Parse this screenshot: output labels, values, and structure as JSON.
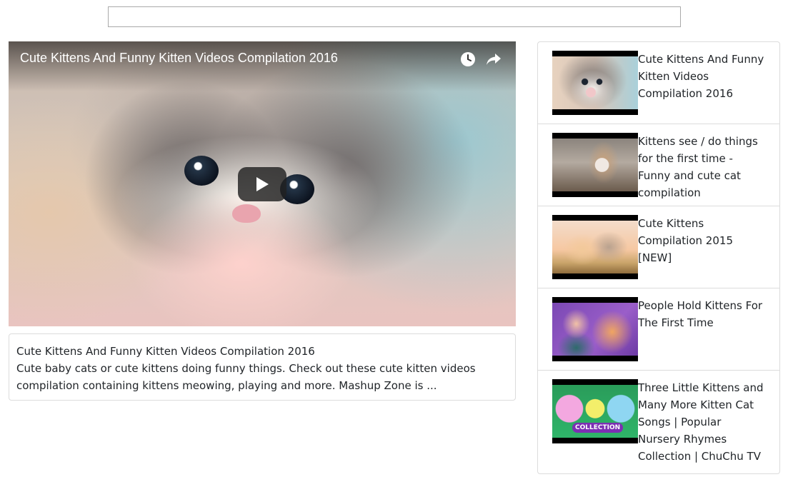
{
  "search": {
    "value": "",
    "placeholder": ""
  },
  "player": {
    "title": "Cute Kittens And Funny Kitten Videos Compilation 2016",
    "icons": {
      "watch_later": "clock-icon",
      "share": "share-arrow-icon",
      "play": "play-icon"
    }
  },
  "description": {
    "title": "Cute Kittens And Funny Kitten Videos Compilation 2016",
    "text": "Cute baby cats or cute kittens doing funny things. Check out these cute kitten videos compilation containing kittens meowing, playing and more. Mashup Zone is ..."
  },
  "related": [
    {
      "title": "Cute Kittens And Funny Kitten Videos Compilation 2016"
    },
    {
      "title": "Kittens see / do things for the first time - Funny and cute cat compilation"
    },
    {
      "title": "Cute Kittens Compilation 2015 [NEW]"
    },
    {
      "title": "People Hold Kittens For The First Time"
    },
    {
      "title": "Three Little Kittens and Many More Kitten Cat Songs | Popular Nursery Rhymes Collection | ChuChu TV",
      "thumb_badge": "COLLECTION"
    }
  ],
  "colors": {
    "border": "#dcdcdc",
    "text": "#212529",
    "overlay_text": "#ffffff"
  }
}
